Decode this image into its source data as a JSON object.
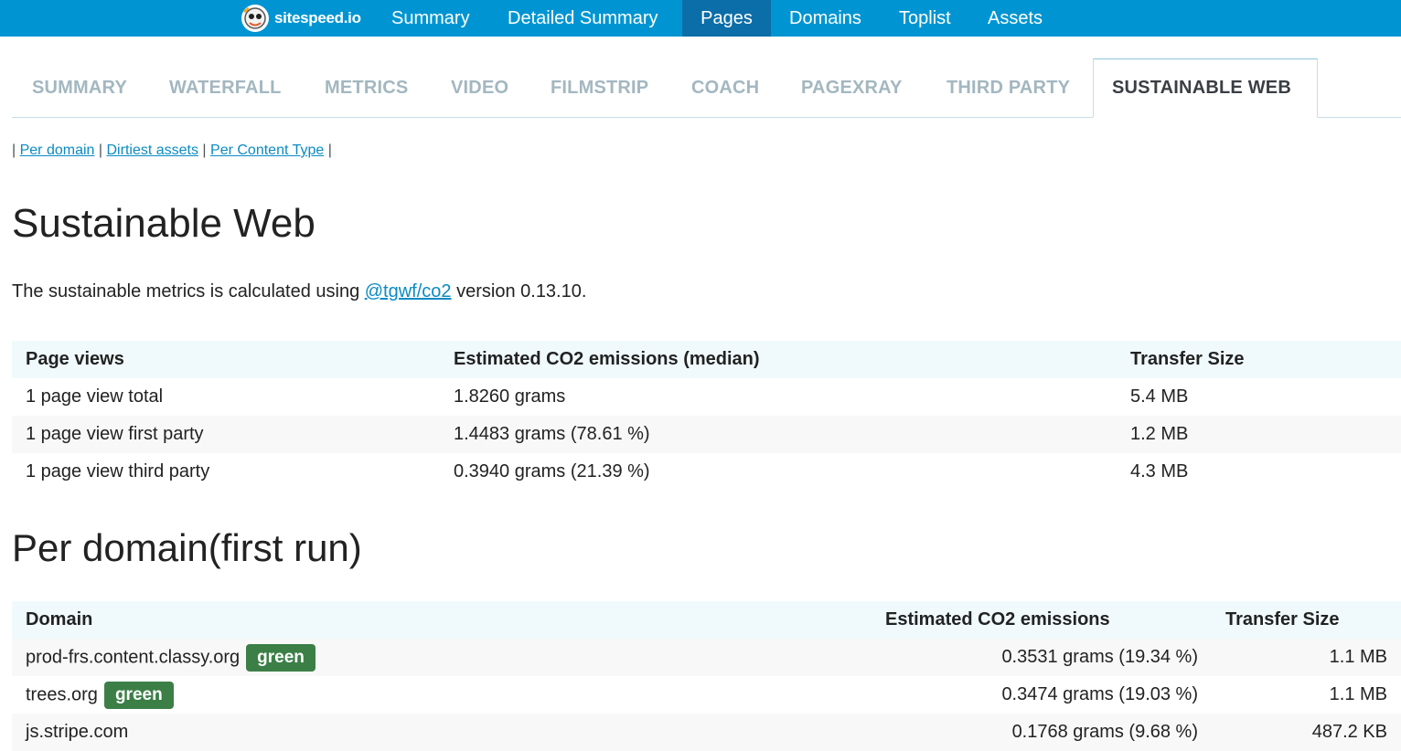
{
  "topnav": {
    "brand": "sitespeed.io",
    "items": [
      "Summary",
      "Detailed Summary",
      "Pages",
      "Domains",
      "Toplist",
      "Assets"
    ],
    "active": "Pages"
  },
  "tabs": {
    "items": [
      "SUMMARY",
      "WATERFALL",
      "METRICS",
      "VIDEO",
      "FILMSTRIP",
      "COACH",
      "PAGEXRAY",
      "THIRD PARTY",
      "SUSTAINABLE WEB"
    ],
    "active": "SUSTAINABLE WEB"
  },
  "anchors": {
    "separator": "|",
    "links": [
      "Per domain",
      "Dirtiest assets",
      "Per Content Type"
    ]
  },
  "page_title": "Sustainable Web",
  "intro": {
    "before": "The sustainable metrics is calculated using ",
    "link": "@tgwf/co2",
    "after": " version 0.13.10."
  },
  "summary_table": {
    "headers": [
      "Page views",
      "Estimated CO2 emissions (median)",
      "Transfer Size"
    ],
    "rows": [
      [
        "1 page view total",
        "1.8260 grams",
        "5.4 MB"
      ],
      [
        "1 page view first party",
        "1.4483 grams (78.61 %)",
        "1.2 MB"
      ],
      [
        "1 page view third party",
        "0.3940 grams (21.39 %)",
        "4.3 MB"
      ]
    ]
  },
  "domain_section": {
    "title": "Per domain(first run)",
    "headers": [
      "Domain",
      "Estimated CO2 emissions",
      "Transfer Size"
    ],
    "badge_label": "green",
    "badge_color": "#3b7f47",
    "rows": [
      {
        "domain": "prod-frs.content.classy.org",
        "green": true,
        "co2": "0.3531 grams (19.34 %)",
        "size": "1.1 MB"
      },
      {
        "domain": "trees.org",
        "green": true,
        "co2": "0.3474 grams (19.03 %)",
        "size": "1.1 MB"
      },
      {
        "domain": "js.stripe.com",
        "green": false,
        "co2": "0.1768 grams (9.68 %)",
        "size": "487.2 KB"
      }
    ]
  },
  "colors": {
    "topbar": "#0095d2",
    "topbar_active": "#0c6ea8",
    "link": "#0a8bc4",
    "tab_inactive": "#a3b7c0",
    "header_bg": "#f0fafd"
  }
}
